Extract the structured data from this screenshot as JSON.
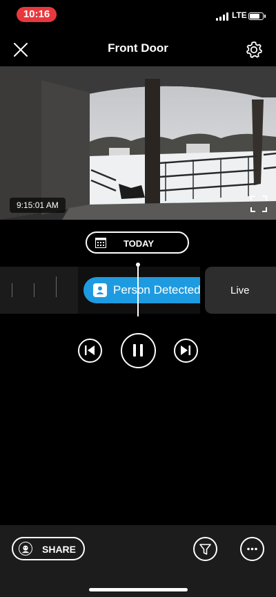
{
  "status_bar": {
    "time": "10:16",
    "network": "LTE",
    "battery_level": 0.85
  },
  "header": {
    "title": "Front Door"
  },
  "video": {
    "timestamp": "9:15:01 AM"
  },
  "date_selector": {
    "label": "TODAY"
  },
  "timeline": {
    "event_label": "Person Detected",
    "live_label": "Live",
    "accent_color": "#1e9be0"
  },
  "playback": {
    "state": "playing"
  },
  "footer": {
    "share_label": "SHARE"
  },
  "icons": [
    "close-icon",
    "gear-icon",
    "fullscreen-icon",
    "calendar-icon",
    "person-icon",
    "skip-previous-icon",
    "pause-icon",
    "skip-next-icon",
    "share-avatar-icon",
    "filter-icon",
    "more-icon"
  ]
}
